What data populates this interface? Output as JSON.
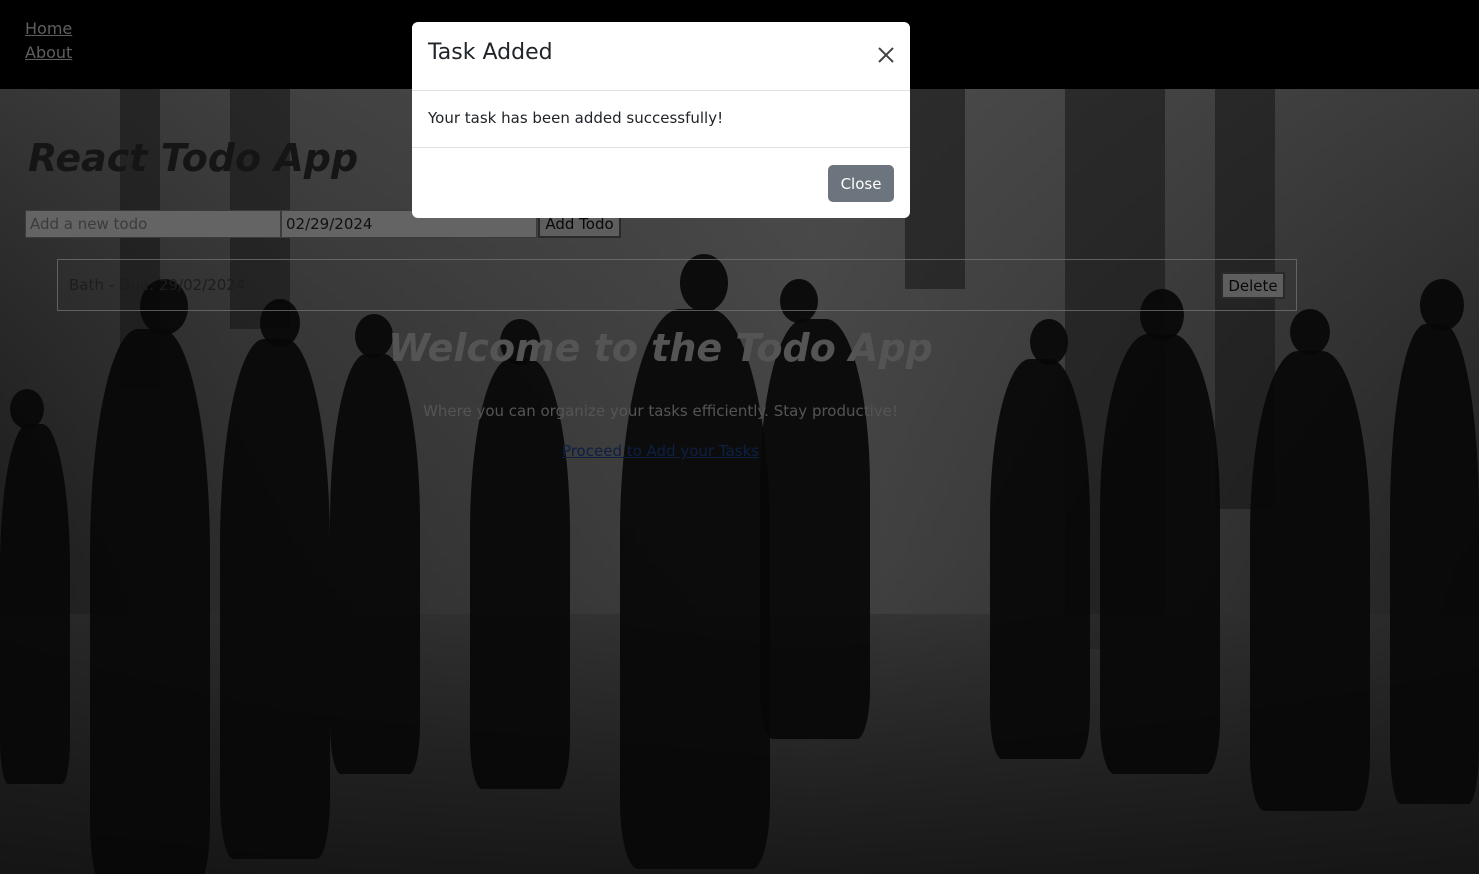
{
  "nav": {
    "home_label": "Home",
    "about_label": "About"
  },
  "app": {
    "title": "React Todo App",
    "new_todo_placeholder": "Add a new todo",
    "date_value": "02/29/2024",
    "add_button_label": "Add Todo",
    "todos": [
      {
        "text": "Bath - Due: 29/02/2024",
        "delete_label": "Delete"
      }
    ]
  },
  "hero": {
    "heading": "Welcome to the Todo App",
    "tagline": "Where you can organize your tasks efficiently. Stay productive!",
    "link_label": "Proceed to Add your Tasks"
  },
  "modal": {
    "title": "Task Added",
    "body": "Your task has been added successfully!",
    "close_label": "Close",
    "close_icon": "close-icon"
  },
  "colors": {
    "modal_button": "#6c757d",
    "link": "#1a3e86",
    "nav_bg": "#000000"
  }
}
